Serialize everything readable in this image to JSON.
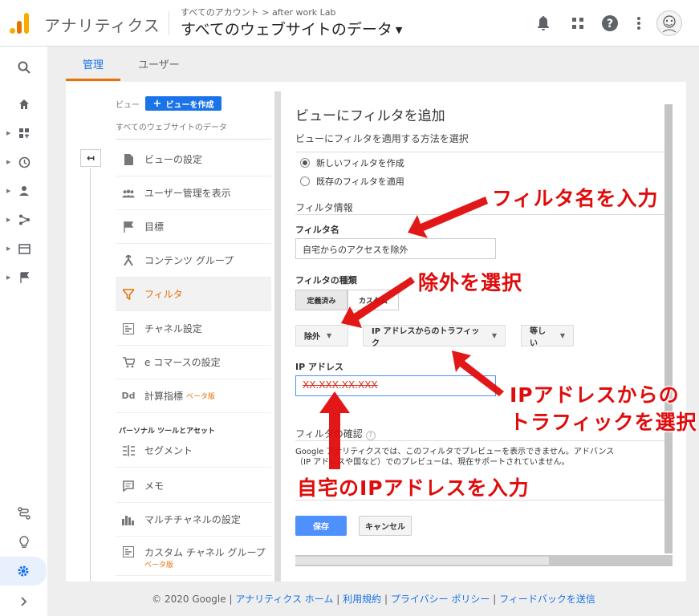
{
  "header": {
    "app_name": "アナリティクス",
    "breadcrumb": "すべてのアカウント > after work Lab",
    "property_title": "すべてのウェブサイトのデータ"
  },
  "tabs": [
    {
      "label": "管理"
    },
    {
      "label": "ユーザー"
    }
  ],
  "view_panel": {
    "view_label": "ビュー",
    "create_button": "ビューを作成",
    "view_name": "すべてのウェブサイトのデータ",
    "nav": [
      {
        "label": "ビューの設定",
        "icon": "document-icon"
      },
      {
        "label": "ユーザー管理を表示",
        "icon": "users-icon"
      },
      {
        "label": "目標",
        "icon": "flag-icon"
      },
      {
        "label": "コンテンツ グループ",
        "icon": "group-icon"
      },
      {
        "label": "フィルタ",
        "icon": "filter-icon"
      },
      {
        "label": "チャネル設定",
        "icon": "channel-icon"
      },
      {
        "label": "e コマースの設定",
        "icon": "cart-icon"
      },
      {
        "label": "計算指標",
        "icon": "dd-icon",
        "badge": "ベータ版"
      },
      {
        "label": "セグメント",
        "icon": "segment-icon"
      },
      {
        "label": "メモ",
        "icon": "memo-icon"
      },
      {
        "label": "マルチチャネルの設定",
        "icon": "bars-icon"
      },
      {
        "label": "カスタム チャネル グループ",
        "icon": "channel-icon",
        "badge": "ベータ版"
      }
    ],
    "section_title": "パーソナル ツールとアセット"
  },
  "form": {
    "title": "ビューにフィルタを追加",
    "subtitle": "ビューにフィルタを適用する方法を選択",
    "radio_new": "新しいフィルタを作成",
    "radio_existing": "既存のフィルタを適用",
    "filter_info": "フィルタ情報",
    "filter_name_label": "フィルタ名",
    "filter_name_value": "自宅からのアクセスを除外",
    "filter_type_label": "フィルタの種類",
    "seg_predefined": "定義済み",
    "seg_custom": "カスタム",
    "dd_exclude": "除外",
    "dd_source": "IP アドレスからのトラフィック",
    "dd_equals": "等しい",
    "ip_label": "IP アドレス",
    "ip_value": "XX.XXX.XX.XXX",
    "confirm_label": "フィルタの確認",
    "confirm_text_1": "Google アナリティクスでは、このフィルタでプレビューを表示できません。アドバンス",
    "confirm_text_2": "（IP アドレスや国など）でのプレビューは、現在サポートされていません。",
    "save": "保存",
    "cancel": "キャンセル"
  },
  "footer": {
    "copyright": "© 2020 Google | ",
    "links": [
      "アナリティクス ホーム",
      "利用規約",
      "プライバシー ポリシー",
      "フィードバックを送信"
    ]
  },
  "annotations": {
    "a1": "フィルタ名を入力",
    "a2": "除外を選択",
    "a3_line1": "IPアドレスからの",
    "a3_line2": "トラフィックを選択",
    "a4": "自宅のIPアドレスを入力"
  },
  "colors": {
    "accent": "#1a73e8",
    "orange": "#e8710a",
    "annotation": "#e00c0c"
  }
}
